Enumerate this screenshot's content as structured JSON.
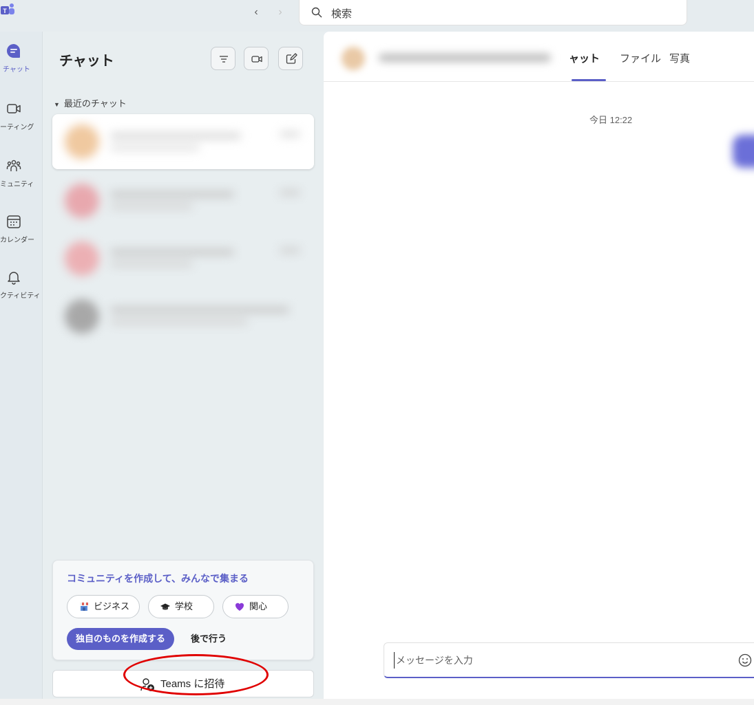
{
  "search": {
    "placeholder": "検索"
  },
  "rail": {
    "items": [
      {
        "label": "チャット",
        "icon": "chat-icon",
        "active": true
      },
      {
        "label": "ーティング",
        "icon": "video-icon",
        "active": false
      },
      {
        "label": "ミュニティ",
        "icon": "community-icon",
        "active": false
      },
      {
        "label": "カレンダー",
        "icon": "calendar-icon",
        "active": false
      },
      {
        "label": "クティビティ",
        "icon": "bell-icon",
        "active": false
      }
    ]
  },
  "chat_list": {
    "title": "チャット",
    "section_label": "最近のチャット"
  },
  "community_card": {
    "title": "コミュニティを作成して、みんなで集まる",
    "chips": [
      "ビジネス",
      "学校",
      "関心"
    ],
    "create_label": "独自のものを作成する",
    "later_label": "後で行う"
  },
  "invite": {
    "label": "Teams に招待"
  },
  "conversation": {
    "tabs": [
      "ャット",
      "ファイル",
      "写真"
    ],
    "date_separator": "今日 12:22",
    "composer_placeholder": "メッセージを入力"
  },
  "colors": {
    "accent": "#5b5fc7",
    "annotation": "#e00000"
  }
}
